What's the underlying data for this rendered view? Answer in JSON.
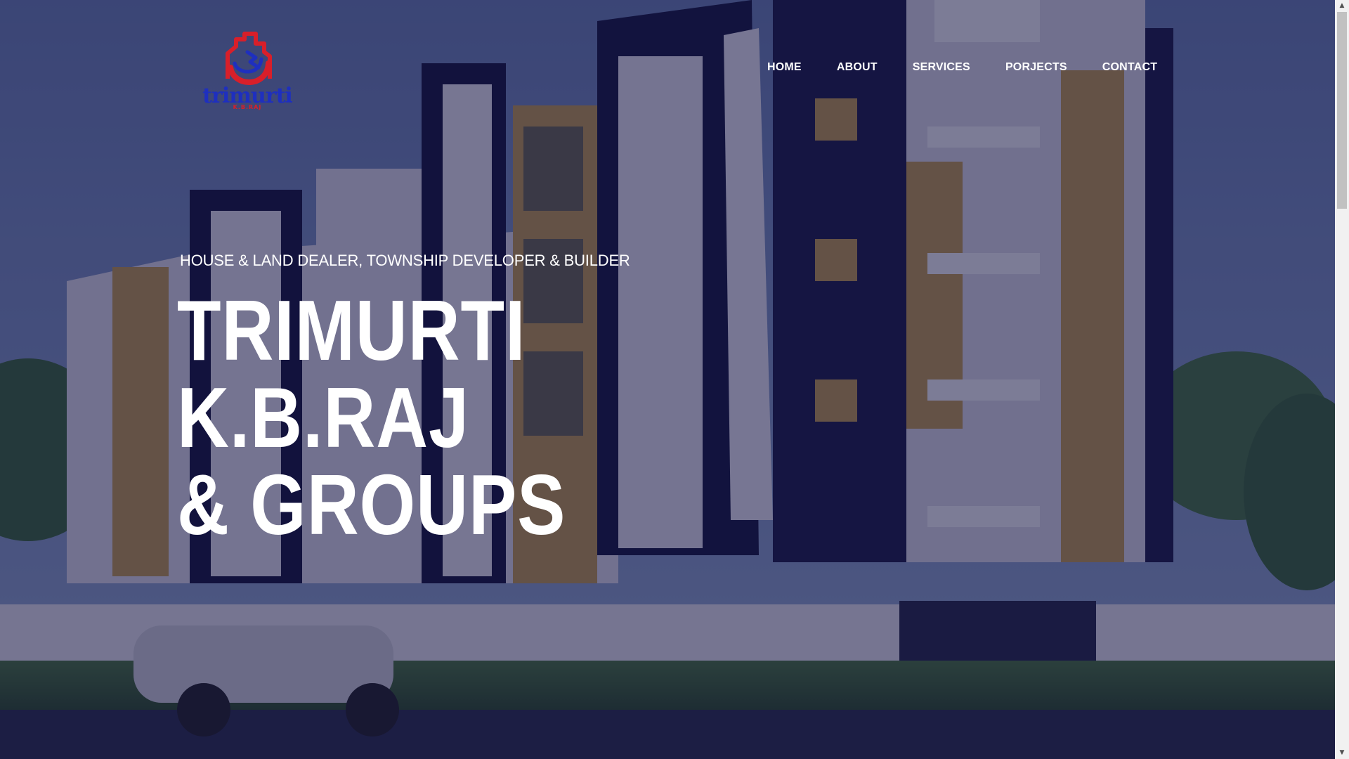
{
  "colors": {
    "overlay": "#10104099",
    "nav_text": "#ffffff",
    "logo_blue": "#1e2fbf",
    "logo_red": "#d81f2a",
    "scrollbar_track": "#f1f1f1",
    "scrollbar_thumb": "#c1c1c1"
  },
  "header": {
    "logo": {
      "text": "trimurti",
      "subtext": "K.B.RAJ",
      "icon": "house-logo-icon"
    },
    "nav": [
      {
        "label": "HOME"
      },
      {
        "label": "ABOUT"
      },
      {
        "label": "SERVICES"
      },
      {
        "label": "PORJECTS"
      },
      {
        "label": "CONTACT"
      }
    ]
  },
  "hero": {
    "tagline": "HOUSE & LAND DEALER, TOWNSHIP DEVELOPER & BUILDER",
    "headline_lines": [
      "TRIMURTI",
      "K.B.RAJ",
      "& GROUPS"
    ],
    "background": "apartment-building-photo"
  },
  "scrollbar": {
    "up_icon": "scroll-up-arrow-icon",
    "down_icon": "scroll-down-arrow-icon"
  }
}
